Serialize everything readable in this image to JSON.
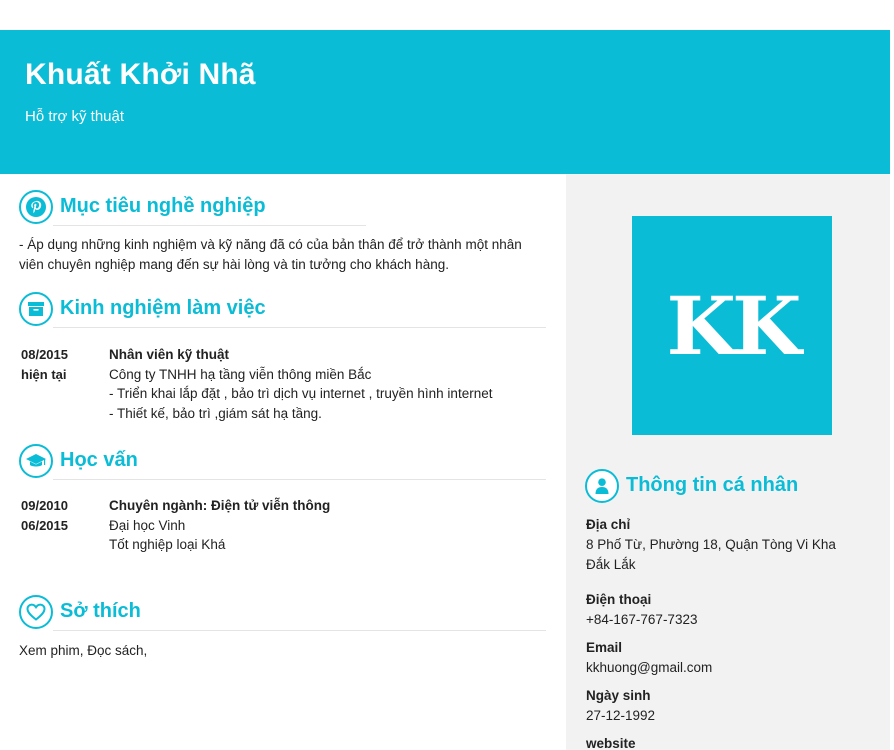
{
  "header": {
    "name": "Khuất Khởi Nhã",
    "role": "Hỗ trợ kỹ thuật"
  },
  "objective": {
    "title": "Mục tiêu nghề nghiệp",
    "icon": "pinterest-icon",
    "text": "- Áp dụng những kinh nghiệm và kỹ năng đã có của bản thân để trở thành một nhân viên chuyên nghiệp mang đến sự hài lòng và tin tưởng cho khách hàng."
  },
  "experience": {
    "title": "Kinh nghiệm làm việc",
    "icon": "archive-box-icon",
    "items": [
      {
        "date_from": "08/2015",
        "date_to": "hiện tại",
        "position": "Nhân viên kỹ thuật",
        "company": "Công ty TNHH hạ tầng viễn thông miền Bắc",
        "details": [
          "- Triển khai lắp đặt , bảo trì dịch vụ internet , truyền hình internet",
          "- Thiết kế, bảo trì ,giám sát hạ tầng."
        ]
      }
    ]
  },
  "education": {
    "title": "Học vấn",
    "icon": "graduation-cap-icon",
    "items": [
      {
        "date_from": "09/2010",
        "date_to": "06/2015",
        "major": "Chuyên ngành: Điện tử viễn thông",
        "school": "Đại học Vinh",
        "grade": "Tốt nghiệp loại Khá"
      }
    ]
  },
  "hobbies": {
    "title": "Sở thích",
    "icon": "heart-icon",
    "text": "Xem phim, Đọc sách,"
  },
  "avatar": {
    "initials": "KK",
    "color": "#0bbcd6"
  },
  "personal": {
    "title": "Thông tin cá nhân",
    "icon": "user-icon",
    "address_label": "Địa chỉ",
    "address_line1": "8 Phố Từ, Phường 18, Quận Tòng Vi Kha",
    "address_line2": "Đắk Lắk",
    "phone_label": "Điện thoại",
    "phone": "+84-167-767-7323",
    "email_label": "Email",
    "email": "kkhuong@gmail.com",
    "dob_label": "Ngày sinh",
    "dob": "27-12-1992",
    "website_label": "website"
  },
  "accent_color": "#0bbcd6"
}
